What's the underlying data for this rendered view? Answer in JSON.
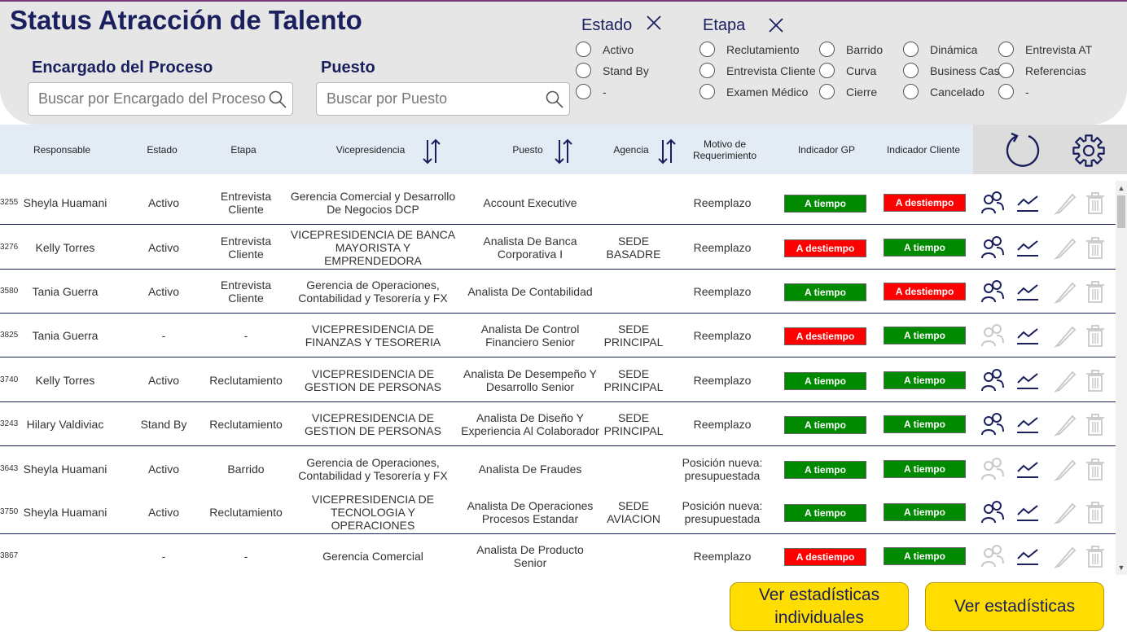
{
  "title": "Status Atracción de Talento",
  "filters": {
    "encargado_label": "Encargado del Proceso",
    "encargado_placeholder": "Buscar por Encargado del Proceso",
    "puesto_label": "Puesto",
    "puesto_placeholder": "Buscar por Puesto",
    "estado_label": "Estado",
    "estado_options": [
      "Activo",
      "Stand By",
      "-"
    ],
    "etapa_label": "Etapa",
    "etapa_options": [
      "Reclutamiento",
      "Barrido",
      "Dinámica",
      "Entrevista AT",
      "Entrevista Cliente",
      "Curva",
      "Business Case",
      "Referencias",
      "Examen Médico",
      "Cierre",
      "Cancelado",
      "-"
    ]
  },
  "columns": {
    "responsable": "Responsable",
    "estado": "Estado",
    "etapa": "Etapa",
    "vicepresidencia": "Vicepresidencia",
    "puesto": "Puesto",
    "agencia": "Agencia",
    "motivo": "Motivo de Requerimiento",
    "indicador_gp": "Indicador GP",
    "indicador_cliente": "Indicador Cliente"
  },
  "rows": [
    {
      "id": "3255",
      "responsable": "Sheyla Huamani",
      "estado": "Activo",
      "etapa": "Entrevista Cliente",
      "vicepresidencia": "Gerencia Comercial y Desarrollo De Negocios DCP",
      "puesto": "Account Executive",
      "agencia": "",
      "motivo": "Reemplazo",
      "gp": "A tiempo",
      "cliente": "A destiempo",
      "candidatos_active": true
    },
    {
      "id": "3276",
      "responsable": "Kelly Torres",
      "estado": "Activo",
      "etapa": "Entrevista Cliente",
      "vicepresidencia": "VICEPRESIDENCIA DE BANCA MAYORISTA Y EMPRENDEDORA",
      "puesto": "Analista De Banca Corporativa I",
      "agencia": "SEDE BASADRE",
      "motivo": "Reemplazo",
      "gp": "A destiempo",
      "cliente": "A tiempo",
      "candidatos_active": true
    },
    {
      "id": "3580",
      "responsable": "Tania Guerra",
      "estado": "Activo",
      "etapa": "Entrevista Cliente",
      "vicepresidencia": "Gerencia de Operaciones, Contabilidad y Tesorería y FX",
      "puesto": "Analista De Contabilidad",
      "agencia": "",
      "motivo": "Reemplazo",
      "gp": "A tiempo",
      "cliente": "A destiempo",
      "candidatos_active": true
    },
    {
      "id": "3825",
      "responsable": "Tania Guerra",
      "estado": "-",
      "etapa": "-",
      "vicepresidencia": "VICEPRESIDENCIA DE FINANZAS Y TESORERIA",
      "puesto": "Analista De Control Financiero Senior",
      "agencia": "SEDE PRINCIPAL",
      "motivo": "Reemplazo",
      "gp": "A destiempo",
      "cliente": "A tiempo",
      "candidatos_active": false
    },
    {
      "id": "3740",
      "responsable": "Kelly Torres",
      "estado": "Activo",
      "etapa": "Reclutamiento",
      "vicepresidencia": "VICEPRESIDENCIA DE GESTION DE PERSONAS",
      "puesto": "Analista De Desempeño Y Desarrollo Senior",
      "agencia": "SEDE PRINCIPAL",
      "motivo": "Reemplazo",
      "gp": "A tiempo",
      "cliente": "A tiempo",
      "candidatos_active": true
    },
    {
      "id": "3243",
      "responsable": "Hilary Valdiviac",
      "estado": "Stand By",
      "etapa": "Reclutamiento",
      "vicepresidencia": "VICEPRESIDENCIA DE GESTION DE PERSONAS",
      "puesto": "Analista De Diseño Y Experiencia Al Colaborador",
      "agencia": "SEDE PRINCIPAL",
      "motivo": "Reemplazo",
      "gp": "A tiempo",
      "cliente": "A tiempo",
      "candidatos_active": true
    },
    {
      "id": "3643",
      "responsable": "Sheyla Huamani",
      "estado": "Activo",
      "etapa": "Barrido",
      "vicepresidencia": "Gerencia de Operaciones, Contabilidad y Tesorería y FX",
      "puesto": "Analista De Fraudes",
      "agencia": "",
      "motivo": "Posición nueva: presupuestada",
      "gp": "A tiempo",
      "cliente": "A tiempo",
      "candidatos_active": false
    },
    {
      "id": "3750",
      "responsable": "Sheyla Huamani",
      "estado": "Activo",
      "etapa": "Reclutamiento",
      "vicepresidencia": "VICEPRESIDENCIA DE TECNOLOGIA Y OPERACIONES",
      "puesto": "Analista De Operaciones Procesos Estandar",
      "agencia": "SEDE AVIACION",
      "motivo": "Posición nueva: presupuestada",
      "gp": "A tiempo",
      "cliente": "A tiempo",
      "candidatos_active": true
    },
    {
      "id": "3867",
      "responsable": "",
      "estado": "-",
      "etapa": "-",
      "vicepresidencia": "Gerencia Comercial",
      "puesto": "Analista De Producto Senior",
      "agencia": "",
      "motivo": "Reemplazo",
      "gp": "A destiempo",
      "cliente": "A tiempo",
      "candidatos_active": false
    }
  ],
  "buttons": {
    "stats_individual": "Ver estadísticas individuales",
    "stats": "Ver estadísticas"
  },
  "colors": {
    "navy": "#1a1f5e",
    "green": "#008a00",
    "red": "#ff0000",
    "yellow": "#ffdd00",
    "header_bg": "#e6e6e6",
    "colhead_bg": "#e3ebf5"
  }
}
